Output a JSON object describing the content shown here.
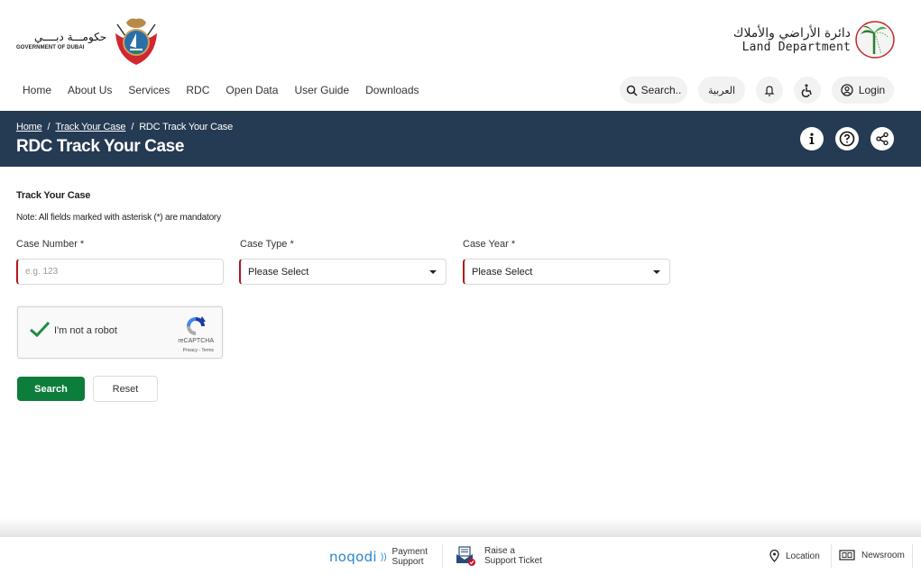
{
  "header": {
    "gov_logo": {
      "arabic": "حكومـــة دبــــي",
      "english": "GOVERNMENT OF DUBAI",
      "icon": "dubai-emblem-icon"
    },
    "dld_logo": {
      "arabic": "دائرة الأراضي والأملاك",
      "english": "Land Department",
      "icon": "palm-tree-logo-icon"
    }
  },
  "nav": {
    "links": [
      "Home",
      "About Us",
      "Services",
      "RDC",
      "Open Data",
      "User Guide",
      "Downloads"
    ],
    "search_label": "Search..",
    "language_label": "العربية",
    "login_label": "Login",
    "icons": {
      "search": "search-icon",
      "notifications": "bell-icon",
      "accessibility": "accessibility-icon",
      "login": "user-circle-icon"
    }
  },
  "banner": {
    "breadcrumb": [
      "Home",
      "Track Your Case",
      "RDC Track Your Case"
    ],
    "separator": "/",
    "title": "RDC Track Your Case",
    "icons": [
      "info-icon",
      "help-icon",
      "share-icon"
    ]
  },
  "form": {
    "title": "Track Your Case",
    "note": "Note: All fields marked with asterisk (*) are mandatory",
    "fields": [
      {
        "label": "Case Number *",
        "type": "text",
        "value": "",
        "placeholder": "e.g. 123"
      },
      {
        "label": "Case Type *",
        "type": "select",
        "value": "Please Select"
      },
      {
        "label": "Case Year *",
        "type": "select",
        "value": "Please Select"
      }
    ],
    "captcha": {
      "label": "I'm not a robot",
      "checked": true,
      "brand": "reCAPTCHA",
      "terms": "Privacy - Terms"
    },
    "search_button": "Search",
    "reset_button": "Reset"
  },
  "footer": {
    "noqodi_brand": "noqodi",
    "payment_line1": "Payment",
    "payment_line2": "Support",
    "ticket_line1": "Raise a",
    "ticket_line2": "Support Ticket",
    "location_label": "Location",
    "newsroom_label": "Newsroom"
  },
  "colors": {
    "banner_bg": "#253a53",
    "primary_green": "#0c7d3b",
    "required_red": "#b2151b",
    "noqodi_blue": "#2a86c7"
  }
}
